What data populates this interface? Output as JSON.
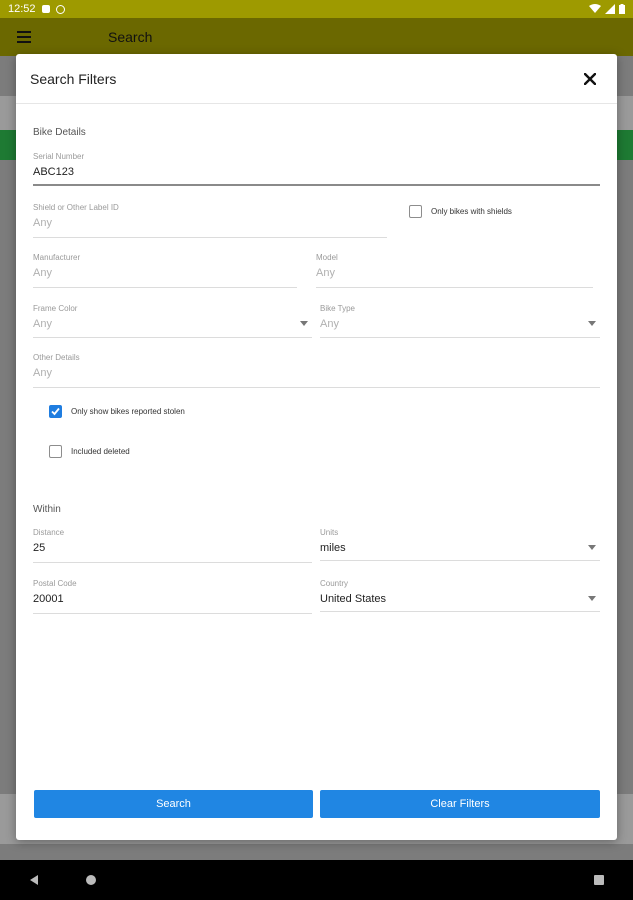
{
  "status_bar": {
    "time": "12:52"
  },
  "app_bar": {
    "title": "Search"
  },
  "dialog": {
    "title": "Search Filters",
    "bike_details": {
      "section_title": "Bike Details",
      "serial_number": {
        "label": "Serial Number",
        "value": "ABC123"
      },
      "shield_id": {
        "label": "Shield or Other Label ID",
        "placeholder": "Any"
      },
      "only_shields": {
        "label": "Only bikes with shields",
        "checked": false
      },
      "manufacturer": {
        "label": "Manufacturer",
        "placeholder": "Any"
      },
      "model": {
        "label": "Model",
        "placeholder": "Any"
      },
      "frame_color": {
        "label": "Frame Color",
        "value": "Any"
      },
      "bike_type": {
        "label": "Bike Type",
        "value": "Any"
      },
      "other_details": {
        "label": "Other Details",
        "placeholder": "Any"
      },
      "only_stolen": {
        "label": "Only show bikes reported stolen",
        "checked": true
      },
      "include_deleted": {
        "label": "Included deleted",
        "checked": false
      }
    },
    "within": {
      "section_title": "Within",
      "distance": {
        "label": "Distance",
        "value": "25"
      },
      "units": {
        "label": "Units",
        "value": "miles"
      },
      "postal_code": {
        "label": "Postal Code",
        "value": "20001"
      },
      "country": {
        "label": "Country",
        "value": "United States"
      }
    },
    "buttons": {
      "search": "Search",
      "clear": "Clear Filters"
    }
  },
  "colors": {
    "status_bar": "#9e9a00",
    "app_bar": "#6b6800",
    "button": "#2086e3",
    "checkbox_checked": "#1f7de0"
  }
}
